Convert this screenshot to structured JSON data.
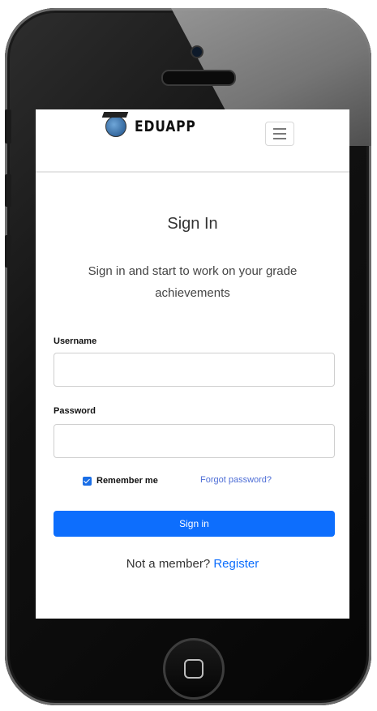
{
  "brand": {
    "name": "EDUAPP"
  },
  "nav": {
    "toggler_icon": "hamburger-icon"
  },
  "signin": {
    "title": "Sign In",
    "subtitle": "Sign in and start to work on your grade achievements",
    "username_label": "Username",
    "username_value": "",
    "password_label": "Password",
    "password_value": "",
    "remember_label": "Remember me",
    "remember_checked": true,
    "forgot_link": "Forgot password?",
    "submit_label": "Sign in",
    "footer_text": "Not a member?",
    "register_link": "Register"
  },
  "colors": {
    "primary": "#0d6efd",
    "link": "#4e6ed6"
  }
}
